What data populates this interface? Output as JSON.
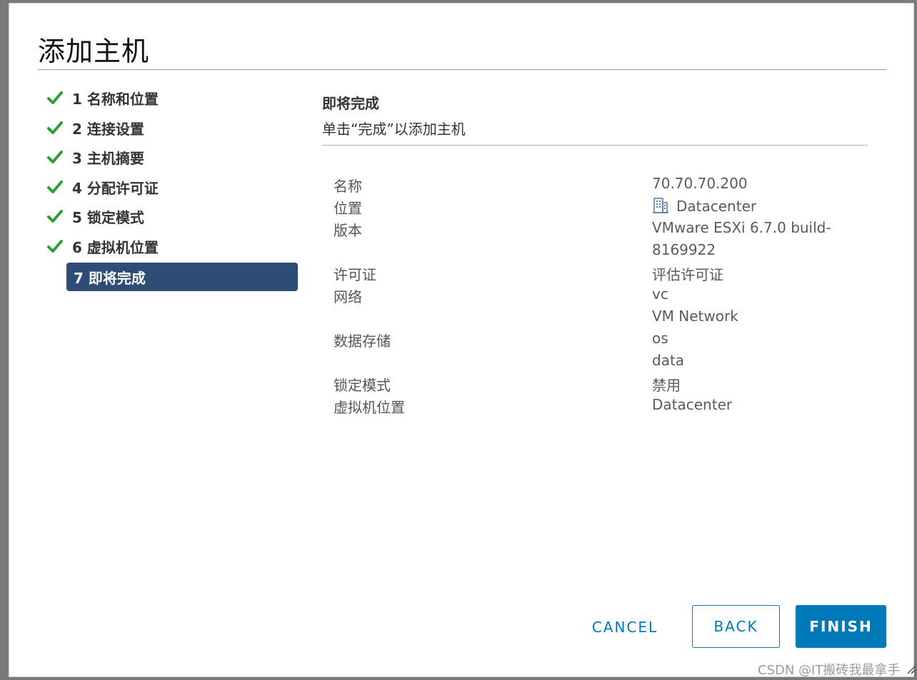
{
  "dialog": {
    "title": "添加主机"
  },
  "steps": [
    {
      "label": "1 名称和位置",
      "done": true
    },
    {
      "label": "2 连接设置",
      "done": true
    },
    {
      "label": "3 主机摘要",
      "done": true
    },
    {
      "label": "4 分配许可证",
      "done": true
    },
    {
      "label": "5 锁定模式",
      "done": true
    },
    {
      "label": "6 虚拟机位置",
      "done": true
    },
    {
      "label": "7 即将完成",
      "done": false,
      "active": true
    }
  ],
  "content": {
    "title": "即将完成",
    "subtitle": "单击“完成”以添加主机",
    "rows": [
      {
        "key": "名称",
        "values": [
          "70.70.70.200"
        ]
      },
      {
        "key": "位置",
        "values": [
          "Datacenter"
        ],
        "icon": "datacenter-icon"
      },
      {
        "key": "版本",
        "values": [
          "VMware ESXi 6.7.0 build-",
          "8169922"
        ]
      },
      {
        "key": "许可证",
        "values": [
          "评估许可证"
        ]
      },
      {
        "key": "网络",
        "values": [
          "vc",
          "VM Network"
        ]
      },
      {
        "key": "数据存储",
        "values": [
          "os",
          "data"
        ]
      },
      {
        "key": "锁定模式",
        "values": [
          "禁用"
        ]
      },
      {
        "key": "虚拟机位置",
        "values": [
          "Datacenter"
        ]
      }
    ]
  },
  "buttons": {
    "cancel": "CANCEL",
    "back": "BACK",
    "finish": "FINISH"
  },
  "watermark": "CSDN @IT搬砖我最拿手",
  "colors": {
    "accent": "#0079b8",
    "active_step": "#2d4d77",
    "check": "#2e9e2e"
  }
}
